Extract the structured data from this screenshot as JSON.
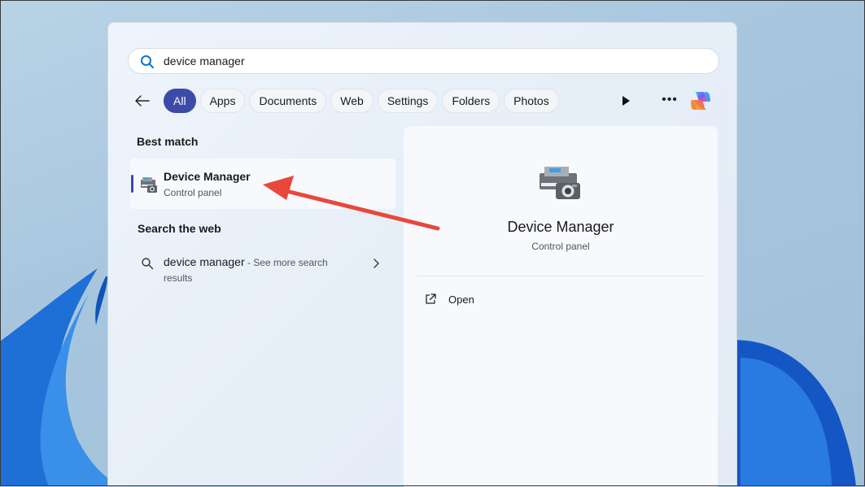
{
  "search": {
    "query": "device manager"
  },
  "filters": [
    "All",
    "Apps",
    "Documents",
    "Web",
    "Settings",
    "Folders",
    "Photos"
  ],
  "filter_active": "All",
  "best_match": {
    "heading": "Best match",
    "title": "Device Manager",
    "subtitle": "Control panel"
  },
  "web": {
    "heading": "Search the web",
    "query": "device manager",
    "more_suffix": " - See more search",
    "more_line2": "results"
  },
  "detail": {
    "title": "Device Manager",
    "subtitle": "Control panel",
    "action_open": "Open"
  },
  "colors": {
    "accent": "#3d4ba8",
    "annotation_arrow": "#e8483b"
  }
}
